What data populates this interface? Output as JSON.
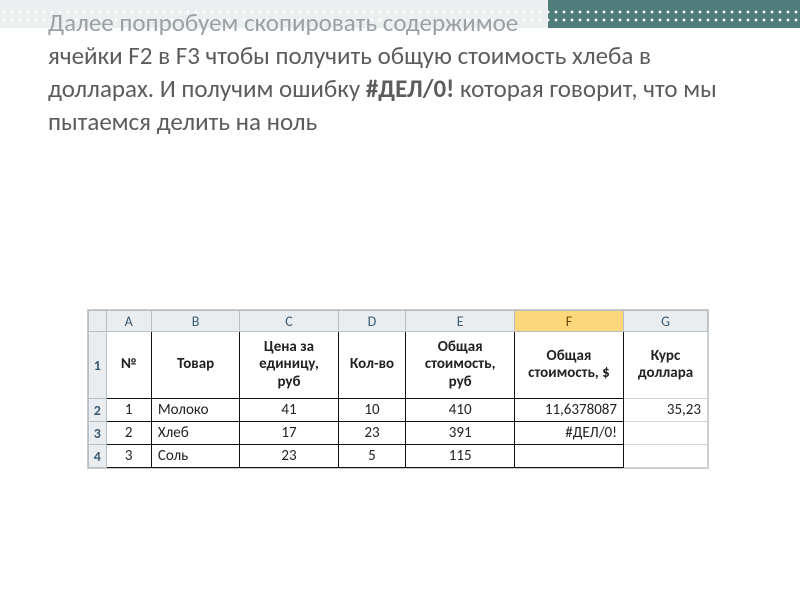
{
  "slide": {
    "line1_faded": "Далее попробуем скопировать содержимое",
    "body_rest": "ячейки F2 в F3 чтобы получить общую стоимость хлеба в долларах. И получим ошибку ",
    "error_bold": "#ДЕЛ/0!",
    "body_tail": " которая говорит, что мы пытаемся делить на ноль"
  },
  "sheet": {
    "col_letters": [
      "A",
      "B",
      "C",
      "D",
      "E",
      "F",
      "G"
    ],
    "row_numbers": [
      "1",
      "2",
      "3",
      "4"
    ],
    "selected_col_index": 5,
    "headers": {
      "A": "№",
      "B": "Товар",
      "C": "Цена за единицу, руб",
      "D": "Кол-во",
      "E": "Общая стоимость, руб",
      "F": "Общая стоимость, $",
      "G": "Курс доллара"
    },
    "rows": [
      {
        "n": "1",
        "item": "Молоко",
        "price": "41",
        "qty": "10",
        "total_rub": "410",
        "total_usd": "11,6378087",
        "rate": "35,23"
      },
      {
        "n": "2",
        "item": "Хлеб",
        "price": "17",
        "qty": "23",
        "total_rub": "391",
        "total_usd": "#ДЕЛ/0!",
        "rate": ""
      },
      {
        "n": "3",
        "item": "Соль",
        "price": "23",
        "qty": "5",
        "total_rub": "115",
        "total_usd": "",
        "rate": ""
      }
    ]
  }
}
